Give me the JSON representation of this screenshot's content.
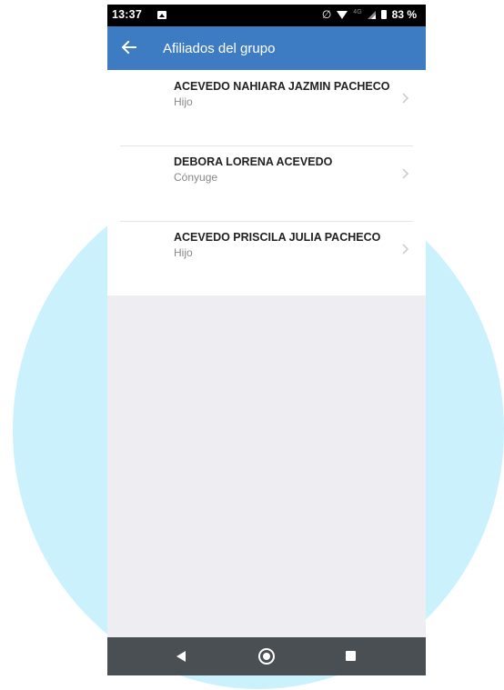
{
  "status_bar": {
    "time": "13:37",
    "battery": "83 %",
    "network_label": "4G"
  },
  "app_bar": {
    "title": "Afiliados del grupo",
    "back_icon": "arrow-left-icon"
  },
  "affiliates": [
    {
      "name": "ACEVEDO NAHIARA JAZMIN PACHECO",
      "relation": "Hijo"
    },
    {
      "name": "DEBORA LORENA ACEVEDO",
      "relation": "Cónyuge"
    },
    {
      "name": "ACEVEDO PRISCILA JULIA PACHECO",
      "relation": "Hijo"
    }
  ],
  "nav_bar": {
    "icons": [
      "back-triangle-icon",
      "home-circle-icon",
      "recents-square-icon"
    ]
  },
  "colors": {
    "app_bar": "#3d7cc3",
    "background": "#ededf2",
    "nav_bar": "#4a4f53",
    "decor_circle": "#cbf1fc"
  }
}
